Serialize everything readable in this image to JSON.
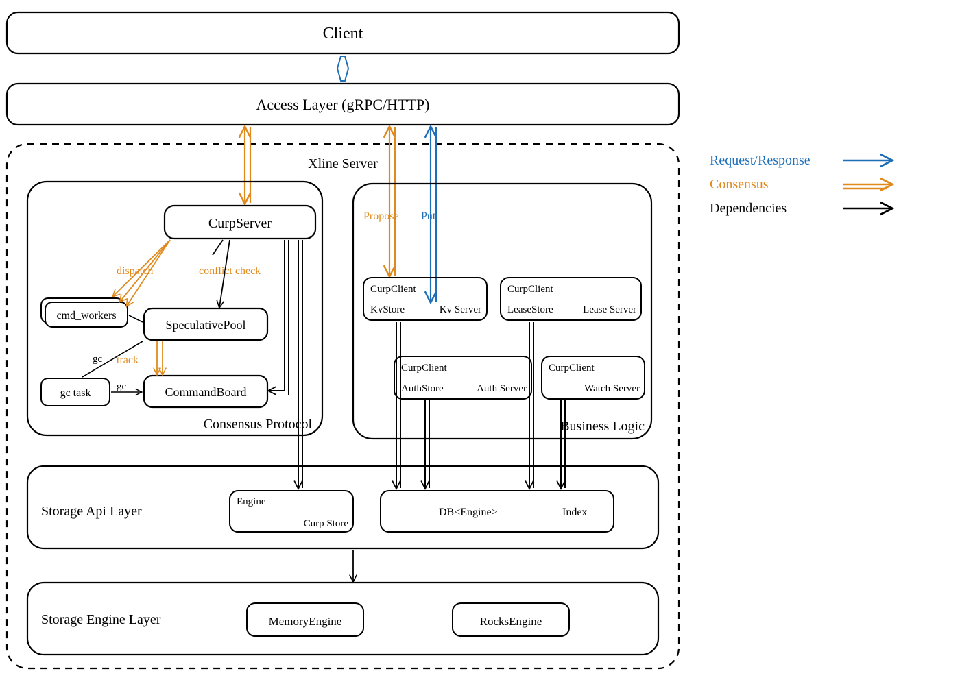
{
  "layers": {
    "client": "Client",
    "access": "Access Layer (gRPC/HTTP)",
    "server_title": "Xline Server",
    "storage_api": "Storage Api Layer",
    "storage_engine": "Storage Engine Layer"
  },
  "consensus": {
    "title": "Consensus Protocol",
    "curp_server": "CurpServer",
    "cmd_workers": "cmd_workers",
    "speculative_pool": "SpeculativePool",
    "gc_task": "gc task",
    "command_board": "CommandBoard",
    "labels": {
      "dispatch": "dispatch",
      "conflict_check": "conflict check",
      "gc1": "gc",
      "gc2": "gc",
      "track": "track"
    }
  },
  "business": {
    "title": "Business Logic",
    "kv": {
      "client": "CurpClient",
      "store": "KvStore",
      "server": "Kv Server"
    },
    "lease": {
      "client": "CurpClient",
      "store": "LeaseStore",
      "server": "Lease Server"
    },
    "auth": {
      "client": "CurpClient",
      "store": "AuthStore",
      "server": "Auth Server"
    },
    "watch": {
      "client": "CurpClient",
      "server": "Watch Server"
    },
    "labels": {
      "propose": "Propose",
      "put": "Put"
    }
  },
  "storage": {
    "curp_store": {
      "engine": "Engine",
      "name": "Curp Store"
    },
    "db": {
      "engine": "DB<Engine>",
      "index": "Index"
    },
    "memory_engine": "MemoryEngine",
    "rocks_engine": "RocksEngine"
  },
  "legend": {
    "req_resp": "Request/Response",
    "consensus": "Consensus",
    "deps": "Dependencies"
  },
  "colors": {
    "blue": "#1e6fb8",
    "orange": "#e08a1e",
    "black": "#000000"
  }
}
